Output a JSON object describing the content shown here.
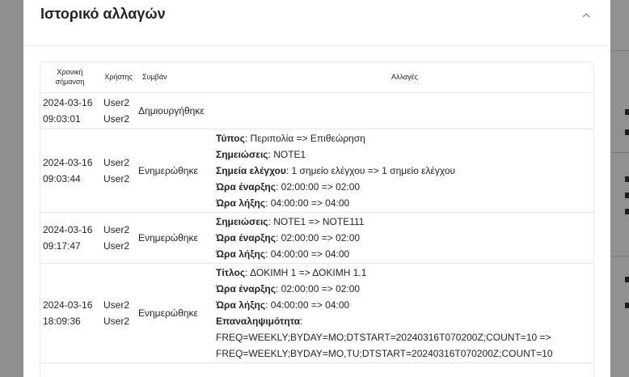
{
  "modal": {
    "title": "Ιστορικό αλλαγών"
  },
  "icons": {
    "collapse": "chevron-up-icon"
  },
  "table": {
    "headers": {
      "time_line1": "Χρονική",
      "time_line2": "σήμανση",
      "user": "Χρήστης",
      "event": "Συμβάν",
      "changes": "Αλλαγές"
    },
    "rows": [
      {
        "date": "2024-03-16",
        "time": "09:03:01",
        "user1": "User2",
        "user2": "User2",
        "event": "Δημιουργήθηκε",
        "changes": []
      },
      {
        "date": "2024-03-16",
        "time": "09:03:44",
        "user1": "User2",
        "user2": "User2",
        "event": "Ενημερώθηκε",
        "changes": [
          {
            "key": "Τύπος",
            "value": ": Περιπολία => Επιθεώρηση"
          },
          {
            "key": "Σημειώσεις",
            "value": ": NOTE1"
          },
          {
            "key": "Σημεία ελέγχου",
            "value": ": 1 σημείο ελέγχου => 1 σημείο ελέγχου"
          },
          {
            "key": "Ώρα έναρξης",
            "value": ": 02:00:00 => 02:00"
          },
          {
            "key": "Ώρα λήξης",
            "value": ": 04:00:00 => 04:00"
          }
        ]
      },
      {
        "date": "2024-03-16",
        "time": "09:17:47",
        "user1": "User2",
        "user2": "User2",
        "event": "Ενημερώθηκε",
        "changes": [
          {
            "key": "Σημειώσεις",
            "value": ": NOTE1 => NOTE111"
          },
          {
            "key": "Ώρα έναρξης",
            "value": ": 02:00:00 => 02:00"
          },
          {
            "key": "Ώρα λήξης",
            "value": ": 04:00:00 => 04:00"
          }
        ]
      },
      {
        "date": "2024-03-16",
        "time": "18:09:36",
        "user1": "User2",
        "user2": "User2",
        "event": "Ενημερώθηκε",
        "changes": [
          {
            "key": "Τίτλος",
            "value": ": ΔΟΚΙΜΗ 1 => ΔΟΚΙΜΗ 1.1"
          },
          {
            "key": "Ώρα έναρξης",
            "value": ": 02:00:00 => 02:00"
          },
          {
            "key": "Ώρα λήξης",
            "value": ": 04:00:00 => 04:00"
          },
          {
            "key": "Επαναληψιμότητα",
            "value": ":"
          }
        ],
        "rrule_lines": [
          "FREQ=WEEKLY;BYDAY=MO;DTSTART=20240316T070200Z;COUNT=10 =>",
          "FREQ=WEEKLY;BYDAY=MO,TU;DTSTART=20240316T070200Z;COUNT=10"
        ]
      }
    ]
  }
}
